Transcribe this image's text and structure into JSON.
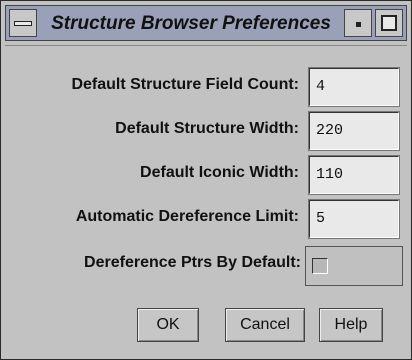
{
  "window": {
    "title": "Structure Browser Preferences"
  },
  "titlebar": {
    "menu_icon": "window-menu-icon",
    "minimize_icon": "minimize-icon",
    "maximize_icon": "maximize-icon"
  },
  "fields": [
    {
      "label": "Default Structure Field Count:",
      "value": "4"
    },
    {
      "label": "Default Structure Width:",
      "value": "220"
    },
    {
      "label": "Default Iconic Width:",
      "value": "110"
    },
    {
      "label": "Automatic Dereference Limit:",
      "value": "5"
    }
  ],
  "toggle": {
    "label": "Dereference Ptrs By Default:",
    "checked": false
  },
  "buttons": {
    "ok": "OK",
    "cancel": "Cancel",
    "help": "Help"
  }
}
